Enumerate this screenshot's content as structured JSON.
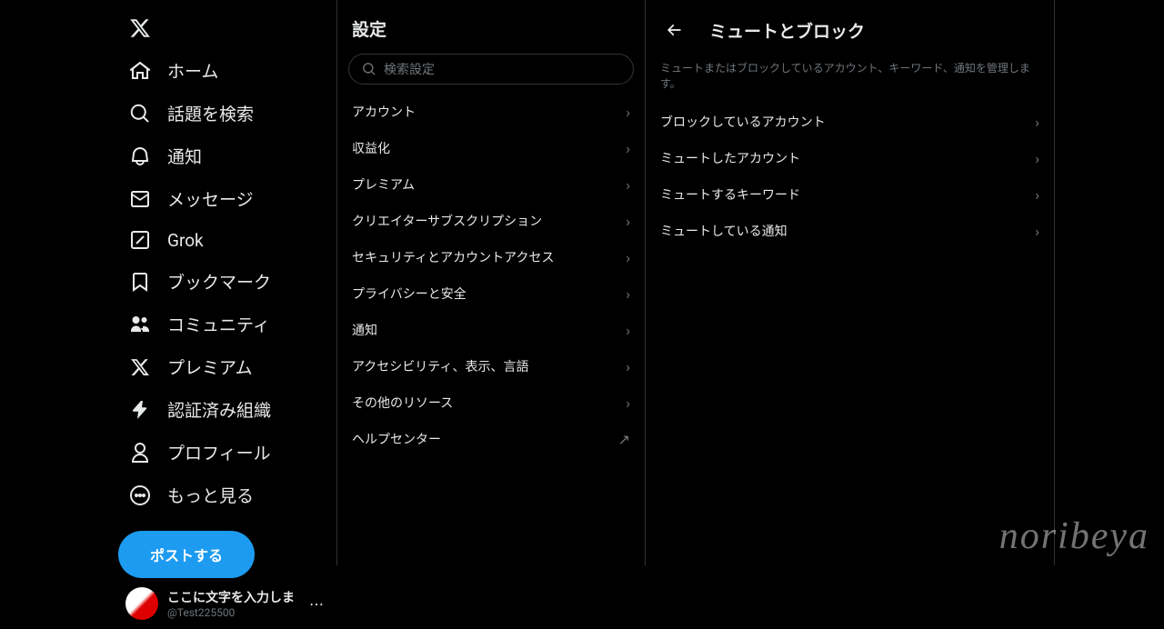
{
  "sidebar": {
    "items": [
      {
        "label": "ホーム"
      },
      {
        "label": "話題を検索"
      },
      {
        "label": "通知"
      },
      {
        "label": "メッセージ"
      },
      {
        "label": "Grok"
      },
      {
        "label": "ブックマーク"
      },
      {
        "label": "コミュニティ"
      },
      {
        "label": "プレミアム"
      },
      {
        "label": "認証済み組織"
      },
      {
        "label": "プロフィール"
      },
      {
        "label": "もっと見る"
      }
    ],
    "post_button": "ポストする"
  },
  "account": {
    "name": "ここに文字を入力しま",
    "handle": "@Test225500"
  },
  "settings": {
    "header": "設定",
    "search_placeholder": "検索設定",
    "items": [
      "アカウント",
      "収益化",
      "プレミアム",
      "クリエイターサブスクリプション",
      "セキュリティとアカウントアクセス",
      "プライバシーと安全",
      "通知",
      "アクセシビリティ、表示、言語",
      "その他のリソース",
      "ヘルプセンター"
    ]
  },
  "detail": {
    "title": "ミュートとブロック",
    "description": "ミュートまたはブロックしているアカウント、キーワード、通知を管理します。",
    "items": [
      "ブロックしているアカウント",
      "ミュートしたアカウント",
      "ミュートするキーワード",
      "ミュートしている通知"
    ]
  },
  "watermark": "noribeya"
}
